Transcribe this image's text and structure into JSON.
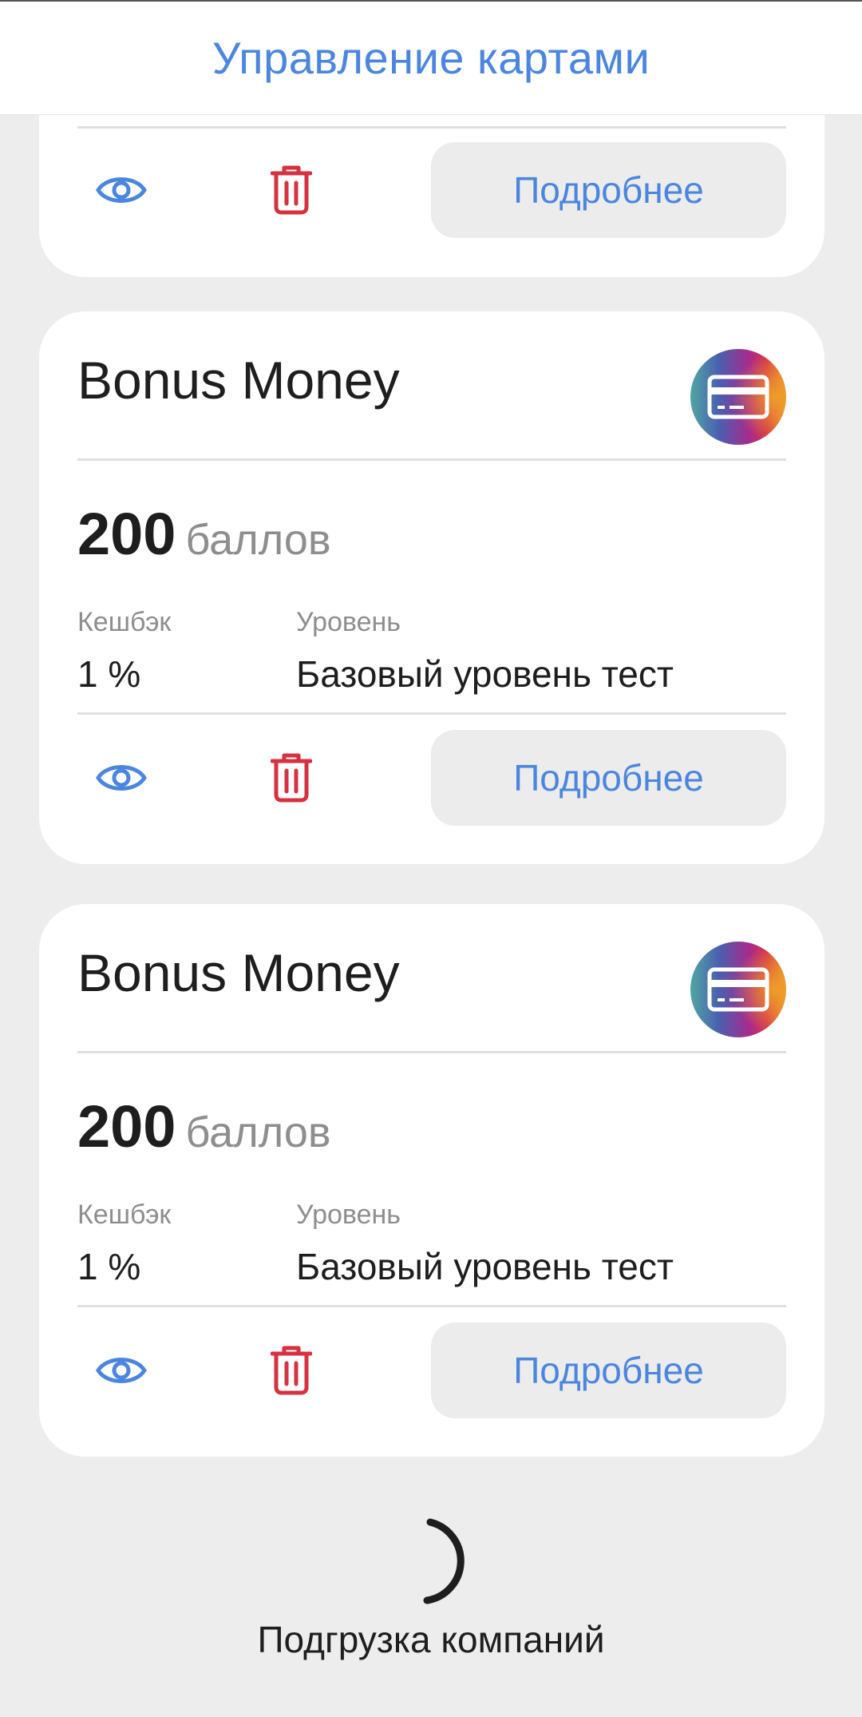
{
  "header": {
    "title": "Управление картами"
  },
  "colors": {
    "accent": "#4a86e0",
    "danger": "#d7303f",
    "background": "#ededed",
    "card": "#ffffff"
  },
  "cards": [
    {
      "details_label": "Подробнее"
    },
    {
      "name": "Bonus Money",
      "logo_icon": "card-icon",
      "points_value": "200",
      "points_unit": "баллов",
      "cashback_label": "Кешбэк",
      "cashback_value": "1 %",
      "level_label": "Уровень",
      "level_value": "Базовый уровень тест",
      "details_label": "Подробнее"
    },
    {
      "name": "Bonus Money",
      "logo_icon": "card-icon",
      "points_value": "200",
      "points_unit": "баллов",
      "cashback_label": "Кешбэк",
      "cashback_value": "1 %",
      "level_label": "Уровень",
      "level_value": "Базовый уровень тест",
      "details_label": "Подробнее"
    }
  ],
  "loader": {
    "text": "Подгрузка компаний"
  }
}
